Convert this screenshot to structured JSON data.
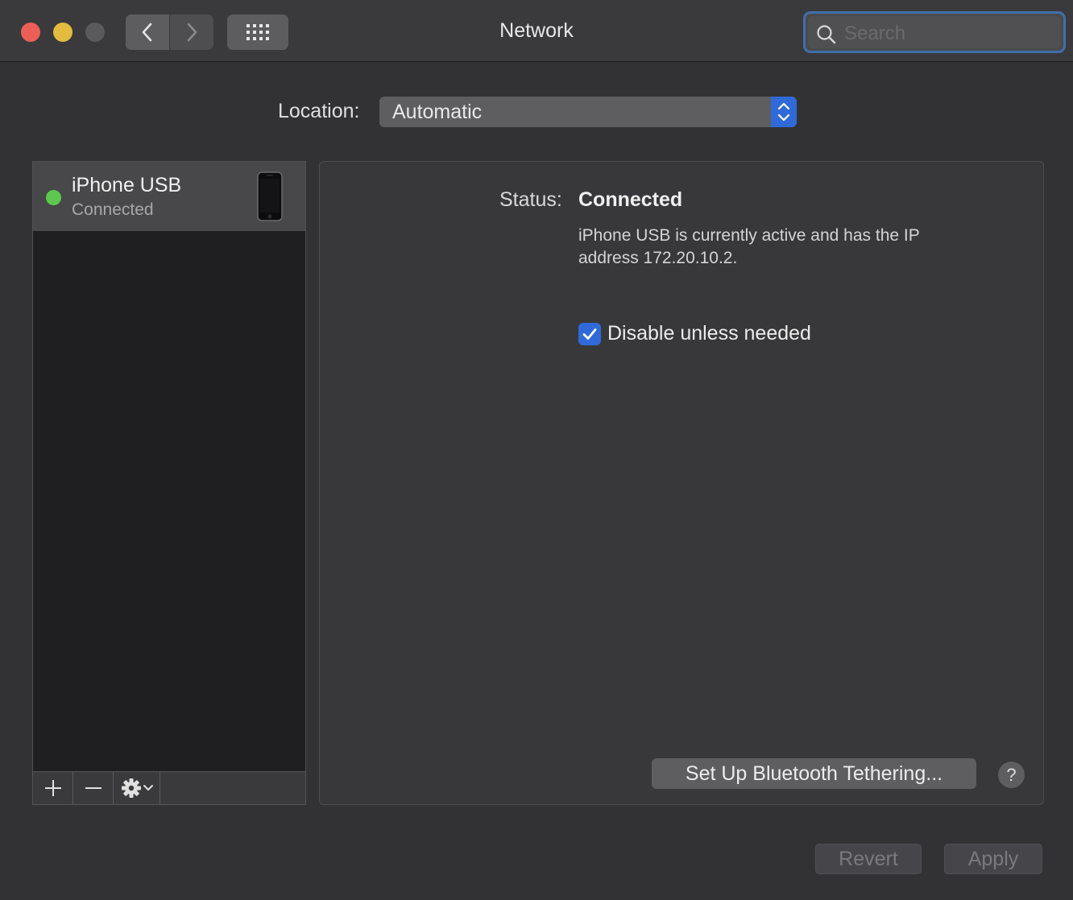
{
  "window": {
    "title": "Network",
    "search_placeholder": "Search"
  },
  "location": {
    "label": "Location:",
    "value": "Automatic"
  },
  "services": [
    {
      "name": "iPhone USB",
      "status": "Connected",
      "status_color": "#5cc84f"
    }
  ],
  "detail": {
    "status_label": "Status:",
    "status_value": "Connected",
    "description": "iPhone USB is currently active and has the IP address 172.20.10.2.",
    "checkbox_label": "Disable unless needed",
    "checkbox_checked": true,
    "tethering_button": "Set Up Bluetooth Tethering...",
    "help_label": "?"
  },
  "footer": {
    "revert_label": "Revert",
    "apply_label": "Apply"
  },
  "colors": {
    "accent": "#2f6ad8",
    "close": "#ec5f56",
    "minimize": "#e2bb3f"
  }
}
